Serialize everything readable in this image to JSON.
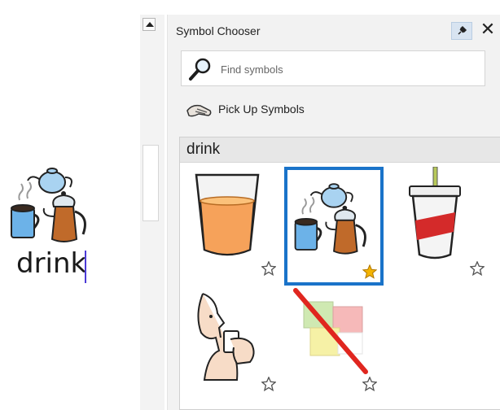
{
  "document": {
    "word": "drink"
  },
  "panel": {
    "title": "Symbol Chooser",
    "close_glyph": "✕",
    "search": {
      "placeholder": "Find symbols",
      "value": ""
    },
    "pickup_label": "Pick Up Symbols",
    "results": {
      "header": "drink",
      "items": [
        {
          "symbol": "glass-of-juice",
          "favorite": false
        },
        {
          "symbol": "teapot-mug-coffeepot",
          "favorite": true,
          "selected": true
        },
        {
          "symbol": "soda-cup-with-straw",
          "favorite": false
        },
        {
          "symbol": "person-drinking",
          "favorite": false
        },
        {
          "symbol": "no-symbol-crossed-out",
          "favorite": false
        }
      ]
    }
  },
  "icons": [
    "scroll-up-arrow-icon",
    "pin-icon",
    "close-icon",
    "magnifier-icon",
    "pickup-hand-icon",
    "star-outline-icon",
    "star-filled-icon"
  ],
  "colors": {
    "selection": "#1a73c9",
    "favorite_star": "#f4b400",
    "caret": "#4b3ad6"
  }
}
